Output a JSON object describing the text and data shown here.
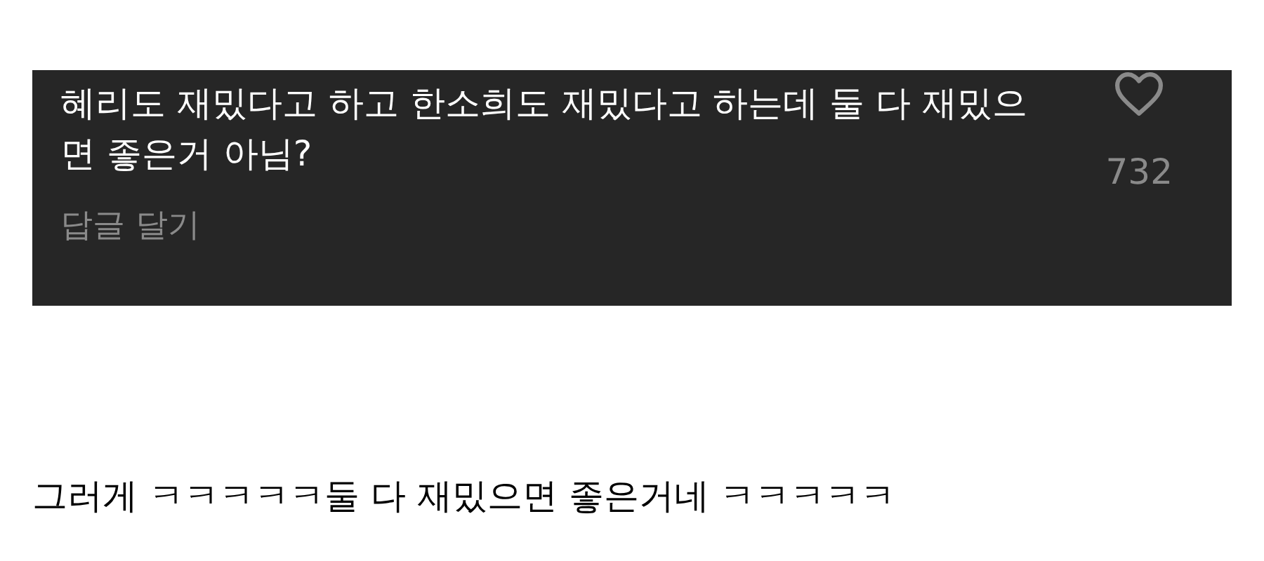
{
  "comment": {
    "text": "혜리도 재밌다고 하고 한소희도 재밌다고 하는데 둘 다 재밌으면 좋은거 아님?",
    "reply_link": "답글 달기",
    "liked": false,
    "like_count": "732"
  },
  "reply": {
    "text": "그러게 ㅋㅋㅋㅋㅋ둘 다 재밌으면 좋은거네 ㅋㅋㅋㅋㅋ"
  }
}
